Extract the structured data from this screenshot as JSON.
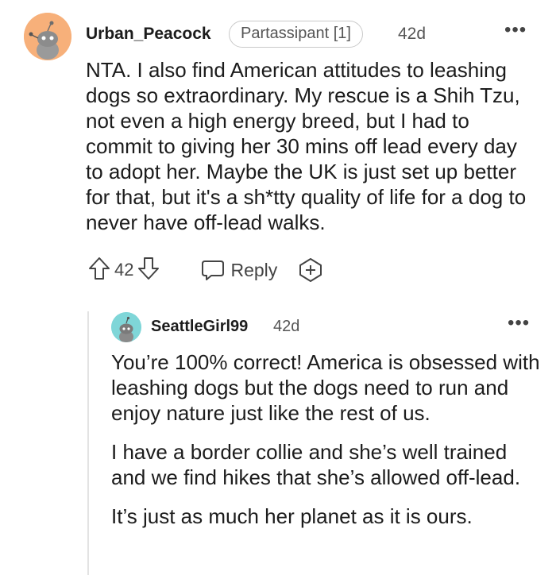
{
  "comment": {
    "username": "Urban_Peacock",
    "flair": "Partassipant [1]",
    "age": "42d",
    "more": "•••",
    "body": "NTA. I also find American attitudes to leashing dogs so extraordinary. My rescue is a Shih Tzu, not even a high energy breed, but I had to commit to giving her 30 mins off lead every day to adopt her. Maybe the UK is just set up better for that, but it's a sh*tty quality of life for a dog to never have off-lead walks.",
    "votes": "42",
    "reply_label": "Reply"
  },
  "reply": {
    "username": "SeattleGirl99",
    "age": "42d",
    "more": "•••",
    "paragraphs": [
      "You’re 100% correct! America is obsessed with leashing dogs but the dogs need to run and enjoy nature just like the rest of us.",
      "I have a border collie and she’s well trained and we find hikes that she’s allowed off-lead.",
      "It’s just as much her planet as it is ours."
    ]
  },
  "colors": {
    "avatar1_bg": "#f7b07a",
    "avatar2_bg": "#7fd6d8",
    "icon": "#444444"
  },
  "icons": [
    "upvote-icon",
    "downvote-icon",
    "comment-bubble-icon",
    "award-plus-icon",
    "more-options-icon",
    "snoo-avatar-icon"
  ]
}
